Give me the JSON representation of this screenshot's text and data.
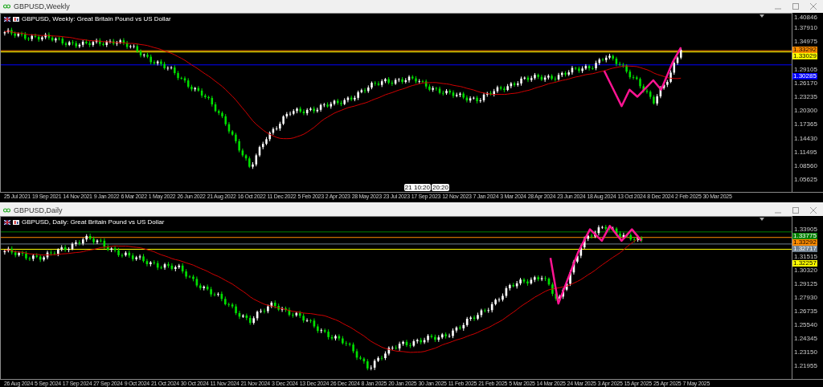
{
  "windows": [
    {
      "title": "GBPUSD,Weekly",
      "chart_header": "GBPUSD, Weekly:  Great Britain Pound vs US Dollar",
      "price_labels": [
        "1.40846",
        "1.37910",
        "1.34975",
        "1.29105",
        "1.26170",
        "1.23235",
        "1.20300",
        "1.17365",
        "1.14430",
        "1.11495",
        "1.08560",
        "1.05625"
      ],
      "price_tags": [
        {
          "text": "1.33292",
          "color": "#ff8c00"
        },
        {
          "text": "1.33029",
          "color": "#ffff00"
        },
        {
          "text": "1.30285",
          "color": "#0000ff"
        }
      ],
      "crosshair_labels": [
        "21 10:20",
        "20:20"
      ],
      "date_labels": [
        "25 Jul 2021",
        "19 Sep 2021",
        "14 Nov 2021",
        "9 Jan 2022",
        "6 Mar 2022",
        "1 May 2022",
        "26 Jun 2022",
        "21 Aug 2022",
        "16 Oct 2022",
        "11 Dec 2022",
        "5 Feb 2023",
        "2 Apr 2023",
        "28 May 2023",
        "23 Jul 2023",
        "17 Sep 2023",
        "12 Nov 2023",
        "7 Jan 2024",
        "3 Mar 2024",
        "28 Apr 2024",
        "23 Jun 2024",
        "18 Aug 2024",
        "13 Oct 2024",
        "8 Dec 2024",
        "2 Feb 2025",
        "30 Mar 2025"
      ]
    },
    {
      "title": "GBPUSD,Daily",
      "chart_header": "GBPUSD, Daily:  Great Britain Pound vs US Dollar",
      "price_labels": [
        "1.33905",
        "1.31515",
        "1.30320",
        "1.29125",
        "1.27930",
        "1.26735",
        "1.25540",
        "1.24345",
        "1.23150",
        "1.21955"
      ],
      "price_tags": [
        {
          "text": "1.33775",
          "color": "#008000"
        },
        {
          "text": "1.33292",
          "color": "#ff8c00"
        },
        {
          "text": "1.32717",
          "color": "#708090"
        },
        {
          "text": "1.32257",
          "color": "#ffff00"
        }
      ],
      "date_labels": [
        "26 Aug 2024",
        "5 Sep 2024",
        "17 Sep 2024",
        "27 Sep 2024",
        "9 Oct 2024",
        "21 Oct 2024",
        "30 Oct 2024",
        "11 Nov 2024",
        "21 Nov 2024",
        "3 Dec 2024",
        "13 Dec 2024",
        "26 Dec 2024",
        "8 Jan 2025",
        "20 Jan 2025",
        "30 Jan 2025",
        "11 Feb 2025",
        "21 Feb 2025",
        "5 Mar 2025",
        "14 Mar 2025",
        "24 Mar 2025",
        "3 Apr 2025",
        "15 Apr 2025",
        "25 Apr 2025",
        "7 May 2025"
      ]
    }
  ]
}
